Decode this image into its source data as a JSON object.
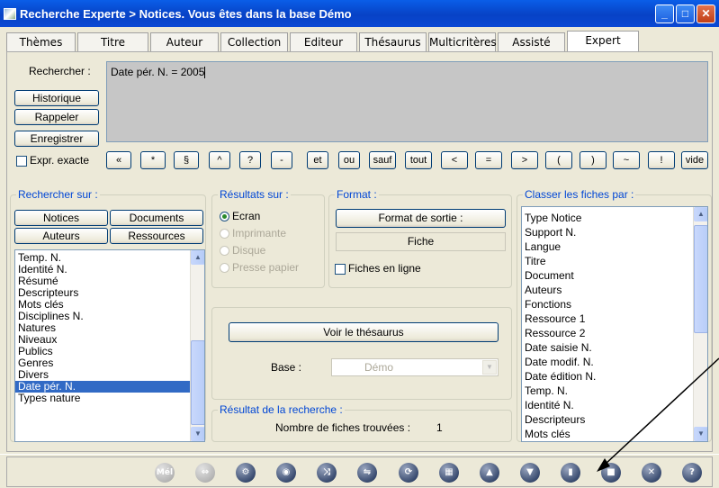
{
  "window": {
    "title": "Recherche Experte > Notices.  Vous êtes dans la base Démo",
    "buttons": {
      "minimize": "_",
      "maximize": "□",
      "close": "✕"
    }
  },
  "tabs": [
    {
      "label": "Thèmes"
    },
    {
      "label": "Titre"
    },
    {
      "label": "Auteur"
    },
    {
      "label": "Collection"
    },
    {
      "label": "Editeur"
    },
    {
      "label": "Thésaurus"
    },
    {
      "label": "Multicritères"
    },
    {
      "label": "Assisté"
    },
    {
      "label": "Expert",
      "active": true
    }
  ],
  "search": {
    "label": "Rechercher :",
    "query": "Date pér. N. = 2005",
    "buttons": {
      "history": "Historique",
      "recall": "Rappeler",
      "save": "Enregistrer"
    },
    "exact_label": "Expr. exacte"
  },
  "operators": [
    "«",
    "*",
    "§",
    "^",
    "?",
    "-",
    "et",
    "ou",
    "sauf",
    "tout",
    "<",
    "=",
    ">",
    "(",
    ")",
    "~",
    "!",
    "vide"
  ],
  "search_on": {
    "legend": "Rechercher sur :",
    "buttons": [
      "Notices",
      "Documents",
      "Auteurs",
      "Ressources"
    ],
    "fields": [
      "Temp. N.",
      "Identité N.",
      "Résumé",
      "Descripteurs",
      "Mots clés",
      "Disciplines N.",
      "Natures",
      "Niveaux",
      "Publics",
      "Genres",
      "Divers",
      "Date pér. N.",
      "Types nature"
    ],
    "selected": "Date pér. N."
  },
  "results_on": {
    "legend": "Résultats sur :",
    "options": [
      {
        "label": "Ecran",
        "checked": true,
        "enabled": true
      },
      {
        "label": "Imprimante",
        "checked": false,
        "enabled": false
      },
      {
        "label": "Disque",
        "checked": false,
        "enabled": false
      },
      {
        "label": "Presse papier",
        "checked": false,
        "enabled": false
      }
    ]
  },
  "format": {
    "legend": "Format :",
    "output_button": "Format de sortie :",
    "value": "Fiche",
    "online_label": "Fiches en ligne"
  },
  "thesaurus": {
    "button": "Voir le thésaurus",
    "base_label": "Base :",
    "base_value": "Démo"
  },
  "result": {
    "legend": "Résultat de la recherche :",
    "count_label": "Nombre de fiches trouvées :",
    "count": "1"
  },
  "sort_by": {
    "legend": "Classer les fiches par :",
    "fields": [
      "Type Notice",
      "Support N.",
      "Langue",
      "Titre",
      "Document",
      "Auteurs",
      "Fonctions",
      "Ressource 1",
      "Ressource 2",
      "Date saisie N.",
      "Date modif. N.",
      "Date édition N.",
      "Temp. N.",
      "Identité N.",
      "Descripteurs",
      "Mots clés"
    ]
  },
  "toolbar": {
    "mail_label": "Mél",
    "icons": [
      "mail-icon",
      "link-icon",
      "settings-icon",
      "view-icon",
      "shuffle-icon",
      "translate-icon",
      "refresh-icon",
      "grid-icon",
      "folder-open-icon",
      "folder-save-icon",
      "trash-icon",
      "book-icon",
      "close-icon",
      "help-icon"
    ]
  }
}
